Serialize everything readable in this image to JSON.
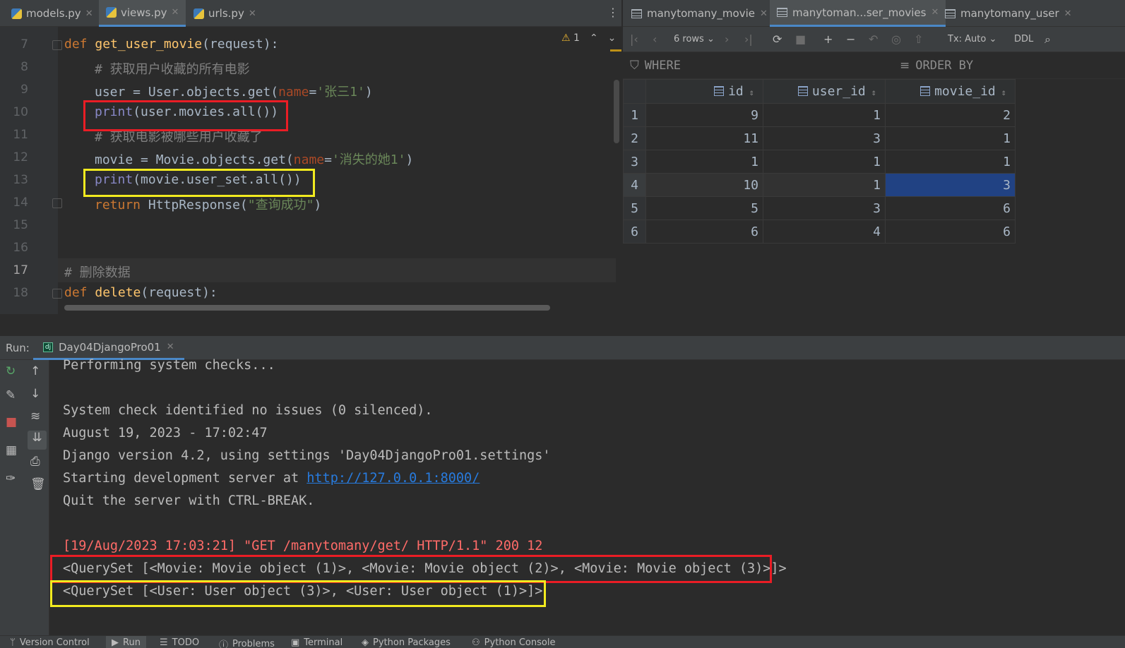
{
  "editor": {
    "tabs": [
      {
        "label": "models.py",
        "active": false
      },
      {
        "label": "views.py",
        "active": true
      },
      {
        "label": "urls.py",
        "active": false
      }
    ],
    "warning_count": "1",
    "lines": [
      {
        "num": "7"
      },
      {
        "num": "8"
      },
      {
        "num": "9"
      },
      {
        "num": "10"
      },
      {
        "num": "11"
      },
      {
        "num": "12"
      },
      {
        "num": "13"
      },
      {
        "num": "14"
      },
      {
        "num": "15"
      },
      {
        "num": "16"
      },
      {
        "num": "17"
      },
      {
        "num": "18"
      }
    ],
    "code": {
      "l7_kw": "def",
      "l7_fn": "get_user_movie",
      "l7_rest": "(request):",
      "l8": "# 获取用户收藏的所有电影",
      "l9_a": "user = User.objects.get(",
      "l9_p": "name",
      "l9_eq": "=",
      "l9_s": "'张三1'",
      "l9_e": ")",
      "l10_b": "print",
      "l10_rest": "(user.movies.all())",
      "l11": "# 获取电影被哪些用户收藏了",
      "l12_a": "movie = Movie.objects.get(",
      "l12_p": "name",
      "l12_eq": "=",
      "l12_s": "'消失的她1'",
      "l12_e": ")",
      "l13_b": "print",
      "l13_rest": "(movie.user_set.all())",
      "l14_kw": "return",
      "l14_a": " HttpResponse(",
      "l14_s": "\"查询成功\"",
      "l14_e": ")",
      "l17": "# 删除数据",
      "l18_kw": "def",
      "l18_fn": "delete",
      "l18_rest": "(request):"
    }
  },
  "db": {
    "tabs": [
      {
        "label": "manytomany_movie",
        "active": false
      },
      {
        "label": "manytoman...ser_movies",
        "active": true
      },
      {
        "label": "manytomany_user",
        "active": false
      }
    ],
    "toolbar": {
      "rows": "6 rows",
      "tx": "Tx: Auto",
      "ddl": "DDL"
    },
    "filter": {
      "where": "WHERE",
      "order_by": "ORDER BY"
    },
    "columns": [
      "id",
      "user_id",
      "movie_id"
    ],
    "rows": [
      {
        "n": "1",
        "id": "9",
        "user_id": "1",
        "movie_id": "2"
      },
      {
        "n": "2",
        "id": "11",
        "user_id": "3",
        "movie_id": "1"
      },
      {
        "n": "3",
        "id": "1",
        "user_id": "1",
        "movie_id": "1"
      },
      {
        "n": "4",
        "id": "10",
        "user_id": "1",
        "movie_id": "3"
      },
      {
        "n": "5",
        "id": "5",
        "user_id": "3",
        "movie_id": "6"
      },
      {
        "n": "6",
        "id": "6",
        "user_id": "4",
        "movie_id": "6"
      }
    ]
  },
  "run": {
    "label": "Run:",
    "tab": "Day04DjangoPro01",
    "console": {
      "l1": "Performing system checks...",
      "l2": "System check identified no issues (0 silenced).",
      "l3": "August 19, 2023 - 17:02:47",
      "l4": "Django version 4.2, using settings 'Day04DjangoPro01.settings'",
      "l5_a": "Starting development server at ",
      "l5_link": "http://127.0.0.1:8000/",
      "l6": "Quit the server with CTRL-BREAK.",
      "l7": "[19/Aug/2023 17:03:21] \"GET /manytomany/get/ HTTP/1.1\" 200 12",
      "l8": "<QuerySet [<Movie: Movie object (1)>, <Movie: Movie object (2)>, <Movie: Movie object (3)>]>",
      "l9": "<QuerySet [<User: User object (3)>, <User: User object (1)>]>"
    }
  },
  "bottom_bar": {
    "items": [
      "Version Control",
      "Run",
      "TODO",
      "Problems",
      "Terminal",
      "Python Packages",
      "Python Console"
    ]
  },
  "colors": {
    "highlight_red": "#ea1d25",
    "highlight_yellow": "#f2ea1f",
    "selection": "#214283",
    "accent": "#4a88c7"
  }
}
